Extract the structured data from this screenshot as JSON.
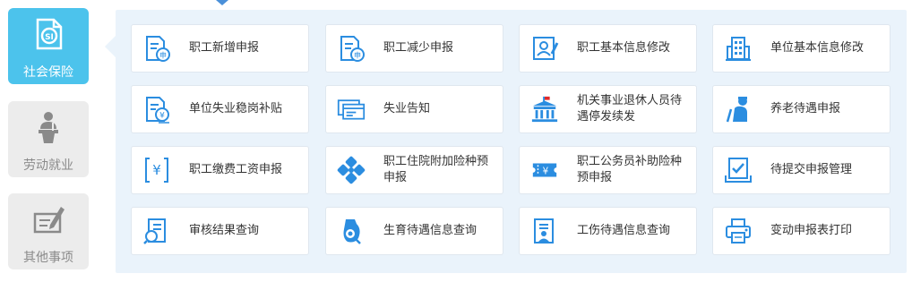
{
  "sidebar": {
    "items": [
      {
        "label": "社会保险",
        "icon": "social-insurance-icon",
        "active": true
      },
      {
        "label": "劳动就业",
        "icon": "speaker-podium-icon",
        "active": false
      },
      {
        "label": "其他事项",
        "icon": "pen-document-icon",
        "active": false
      }
    ]
  },
  "grid": {
    "rows": [
      [
        {
          "label": "职工新增申报",
          "icon": "doc-stamp-icon"
        },
        {
          "label": "职工减少申报",
          "icon": "doc-stamp-icon"
        },
        {
          "label": "职工基本信息修改",
          "icon": "id-card-edit-icon"
        },
        {
          "label": "单位基本信息修改",
          "icon": "building-icon"
        }
      ],
      [
        {
          "label": "单位失业稳岗补贴",
          "icon": "doc-yuan-icon"
        },
        {
          "label": "失业告知",
          "icon": "windows-icon"
        },
        {
          "label": "机关事业退休人员待遇停发续发",
          "icon": "government-building-icon"
        },
        {
          "label": "养老待遇申报",
          "icon": "elderly-person-icon"
        }
      ],
      [
        {
          "label": "职工缴费工资申报",
          "icon": "bracket-yuan-icon"
        },
        {
          "label": "职工住院附加险种预申报",
          "icon": "medical-cross-icon"
        },
        {
          "label": "职工公务员补助险种预申报",
          "icon": "ticket-yuan-icon"
        },
        {
          "label": "待提交申报管理",
          "icon": "checklist-tray-icon"
        }
      ],
      [
        {
          "label": "审核结果查询",
          "icon": "doc-search-icon"
        },
        {
          "label": "生育待遇信息查询",
          "icon": "maternity-icon"
        },
        {
          "label": "工伤待遇信息查询",
          "icon": "worker-doc-icon"
        },
        {
          "label": "变动申报表打印",
          "icon": "printer-icon"
        }
      ]
    ]
  },
  "colors": {
    "accent": "#4cc3ec",
    "icon": "#2b8de0",
    "panel": "#eaf3fb"
  }
}
